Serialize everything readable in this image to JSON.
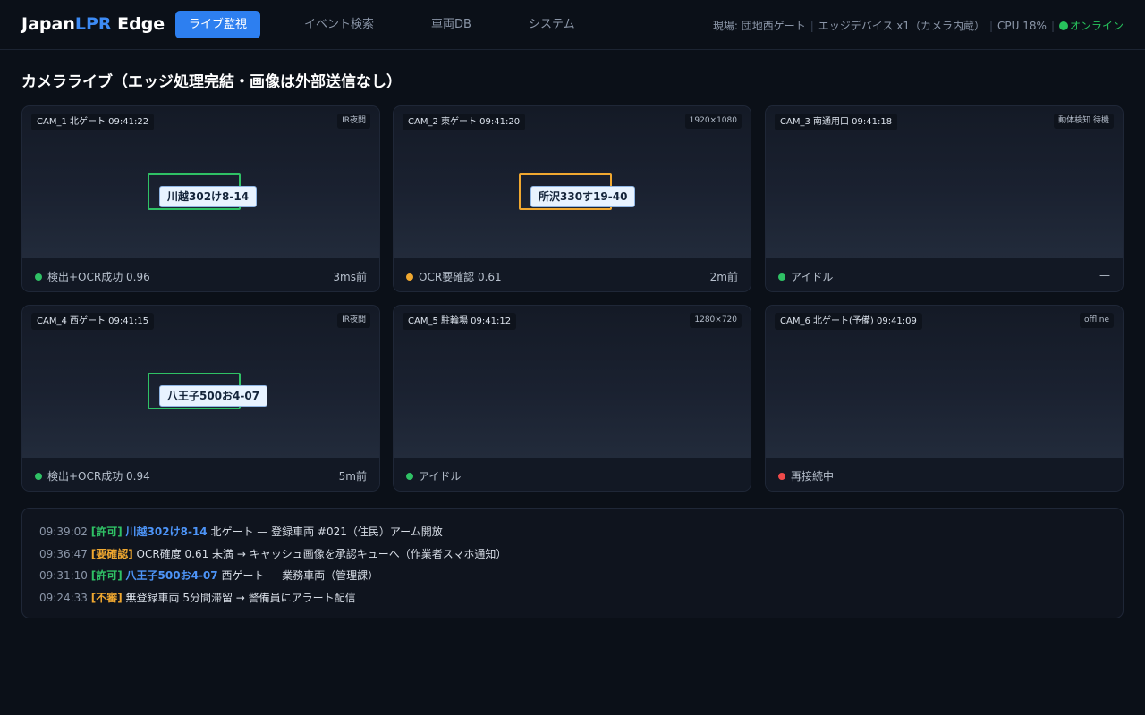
{
  "header": {
    "brand_prefix": "Japan",
    "brand_accent": "LPR",
    "brand_suffix": " Edge",
    "nav": [
      {
        "label": "ライブ監視",
        "active": true
      },
      {
        "label": "イベント検索",
        "active": false
      },
      {
        "label": "車両DB",
        "active": false
      },
      {
        "label": "システム",
        "active": false
      }
    ],
    "site": "現場: 団地西ゲート",
    "device": "エッジデバイス x1（カメラ内蔵）",
    "cpu": "CPU 18%",
    "online": "オンライン"
  },
  "page_title": "カメラライブ（エッジ処理完結・画像は外部送信なし）",
  "cameras": [
    {
      "label": "CAM_1 北ゲート 09:41:22",
      "tag": "IR夜間",
      "plate": "川越302け8-14",
      "status": "検出+OCR成功 0.96",
      "ago": "3ms前",
      "status_color": "#2fc165"
    },
    {
      "label": "CAM_2 東ゲート 09:41:20",
      "tag": "1920×1080",
      "plate": "所沢330す19-40",
      "status": "OCR要確認 0.61",
      "ago": "2m前",
      "status_color": "#f0a830"
    },
    {
      "label": "CAM_3 南通用口 09:41:18",
      "tag": "動体検知 待機",
      "plate": "",
      "status": "アイドル",
      "ago": "—",
      "status_color": "#2fc165"
    },
    {
      "label": "CAM_4 西ゲート 09:41:15",
      "tag": "IR夜間",
      "plate": "八王子500お4-07",
      "status": "検出+OCR成功 0.94",
      "ago": "5m前",
      "status_color": "#2fc165"
    },
    {
      "label": "CAM_5 駐輪場 09:41:12",
      "tag": "1280×720",
      "plate": "",
      "status": "アイドル",
      "ago": "—",
      "status_color": "#2fc165"
    },
    {
      "label": "CAM_6 北ゲート(予備) 09:41:09",
      "tag": "offline",
      "plate": "",
      "status": "再接続中",
      "ago": "—",
      "status_color": "#ef4a4a"
    }
  ],
  "log": [
    {
      "time": "09:39:02",
      "tag": "[許可]",
      "plate": "川越302け8-14",
      "text": " 北ゲート — 登録車両 #021（住民）アーム開放"
    },
    {
      "time": "09:36:47",
      "tag": "[要確認]",
      "plate": "",
      "text": " OCR確度 0.61 未満 → キャッシュ画像を承認キューへ（作業者スマホ通知）"
    },
    {
      "time": "09:31:10",
      "tag": "[許可]",
      "plate": "八王子500お4-07",
      "text": " 西ゲート — 業務車両（管理課）"
    },
    {
      "time": "09:24:33",
      "tag": "[不審]",
      "plate": "",
      "text": " 無登録車両 5分間滞留 → 警備員にアラート配信"
    }
  ]
}
